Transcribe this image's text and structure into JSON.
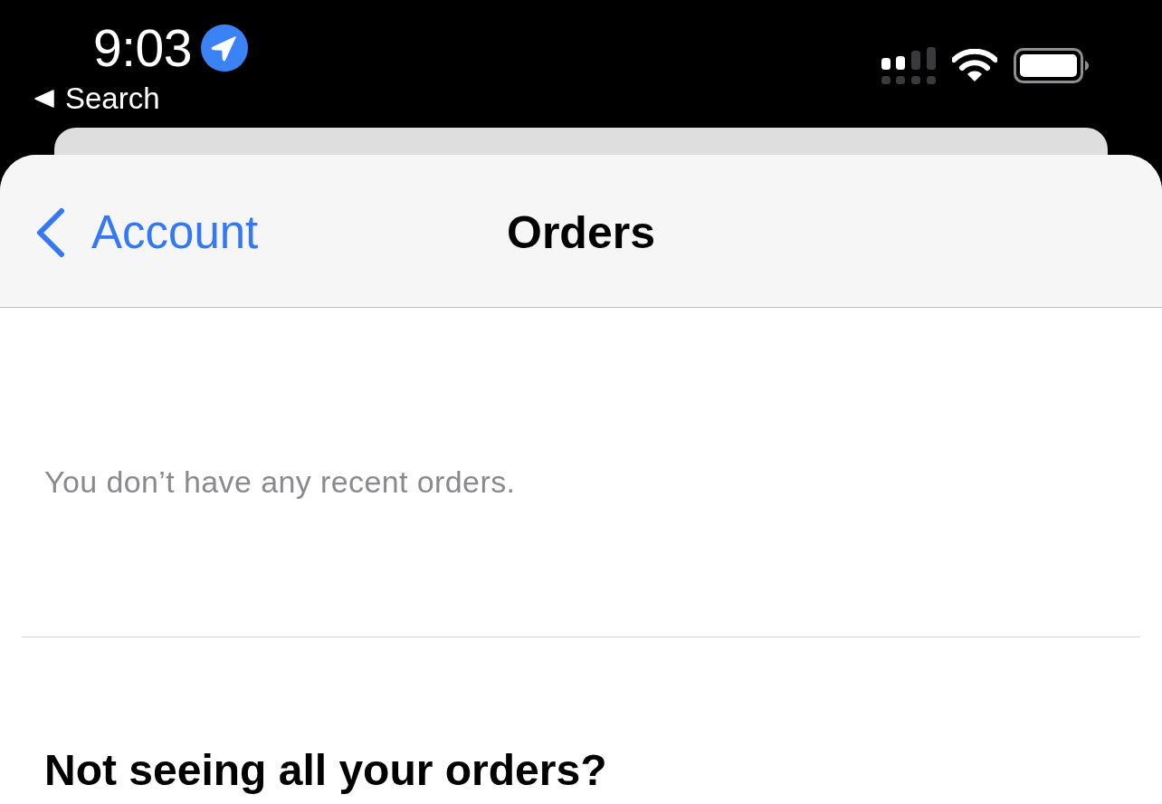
{
  "status_bar": {
    "time": "9:03",
    "back_link": "Search"
  },
  "nav_bar": {
    "back_label": "Account",
    "title": "Orders"
  },
  "empty_message": "You don’t have any recent orders.",
  "section_heading": "Not seeing all your orders?"
}
